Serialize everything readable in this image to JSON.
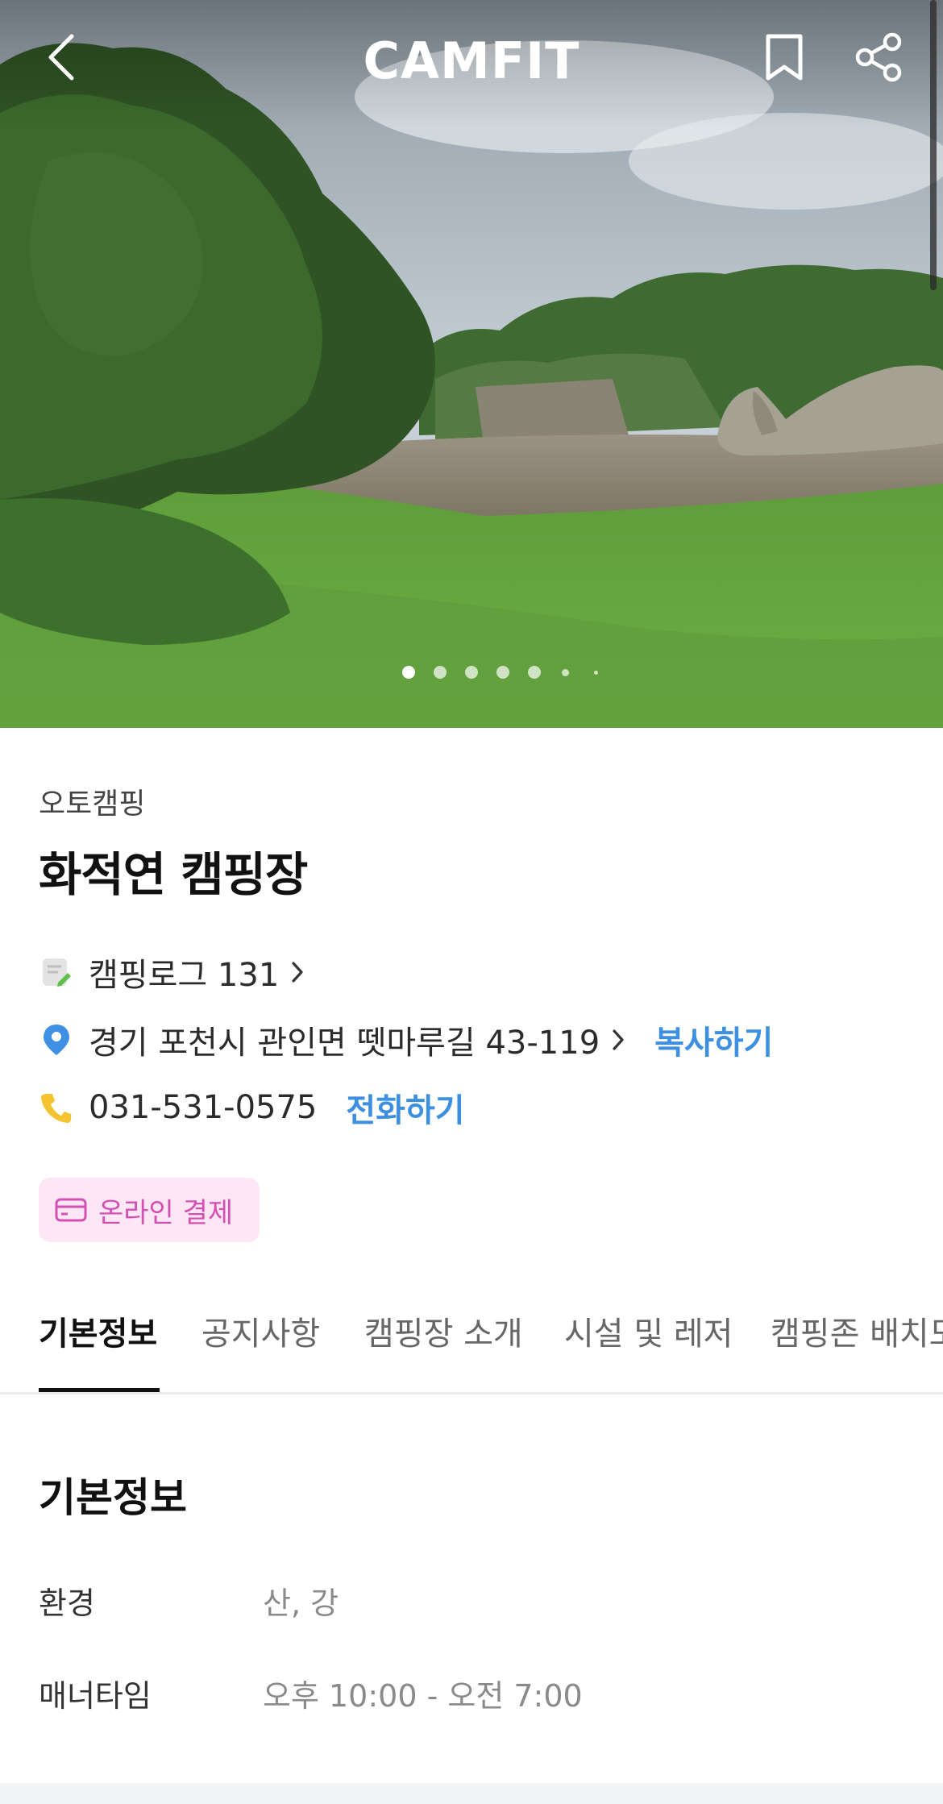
{
  "header": {
    "logo": "CAMFIT",
    "back_icon": "chevron-left-icon",
    "bookmark_icon": "bookmark-icon",
    "share_icon": "share-icon"
  },
  "hero": {
    "slide_count": 7,
    "active_slide": 1
  },
  "camp": {
    "category": "오토캠핑",
    "name": "화적연 캠핑장",
    "camping_log": "캠핑로그 131",
    "address": "경기 포천시 관인면 뗏마루길 43-119",
    "copy_label": "복사하기",
    "phone": "031-531-0575",
    "call_label": "전화하기",
    "payment_badge": "온라인 결제"
  },
  "tabs": [
    {
      "label": "기본정보",
      "active": true
    },
    {
      "label": "공지사항",
      "active": false
    },
    {
      "label": "캠핑장 소개",
      "active": false
    },
    {
      "label": "시설 및 레저",
      "active": false
    },
    {
      "label": "캠핑존 배치도",
      "active": false
    }
  ],
  "basic_info": {
    "title": "기본정보",
    "rows": [
      {
        "label": "환경",
        "value": "산, 강"
      },
      {
        "label": "매너타임",
        "value": "오후 10:00 - 오전 7:00"
      }
    ]
  },
  "colors": {
    "accent_blue": "#3d8fe0",
    "badge_pink": "#d44fb2",
    "badge_bg": "#fde7f5"
  }
}
